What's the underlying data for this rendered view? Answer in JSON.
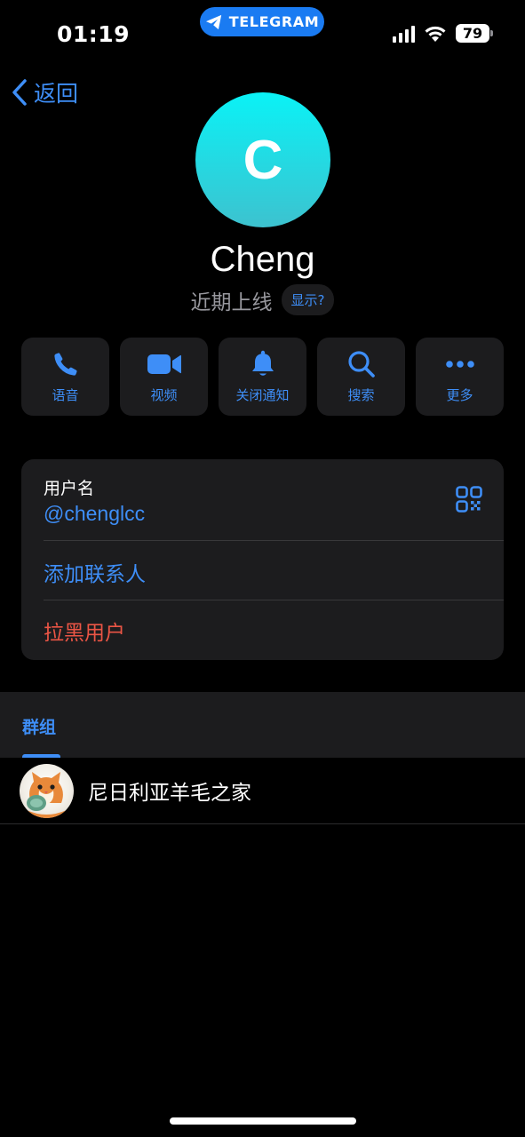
{
  "status_bar": {
    "time": "01:19",
    "app_pill": "TELEGRAM",
    "battery": "79"
  },
  "nav": {
    "back_label": "返回"
  },
  "profile": {
    "initial": "C",
    "name": "Cheng",
    "last_seen": "近期上线",
    "show_label": "显示?"
  },
  "actions": [
    {
      "label": "语音",
      "icon": "phone-icon"
    },
    {
      "label": "视频",
      "icon": "video-icon"
    },
    {
      "label": "关闭通知",
      "icon": "bell-icon"
    },
    {
      "label": "搜索",
      "icon": "search-icon"
    },
    {
      "label": "更多",
      "icon": "more-icon"
    }
  ],
  "info": {
    "username_label": "用户名",
    "username": "@chenglcc",
    "add_contact": "添加联系人",
    "block_user": "拉黑用户"
  },
  "groups": {
    "header": "群组",
    "items": [
      {
        "name": "尼日利亚羊毛之家"
      }
    ]
  },
  "colors": {
    "accent": "#3e8ef7",
    "destructive": "#eb5545",
    "card": "#1c1c1e",
    "background": "#000000",
    "secondary_text": "#98989e"
  }
}
